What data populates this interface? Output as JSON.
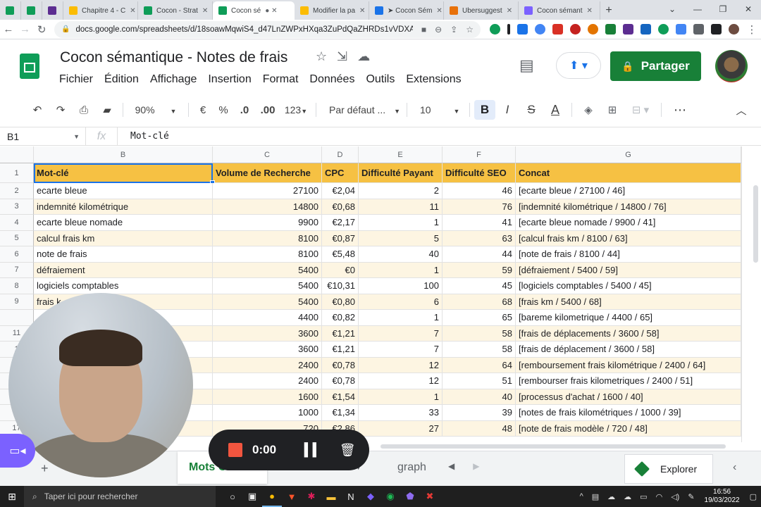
{
  "browser": {
    "tabs": [
      {
        "title": "",
        "color": "#0f9d58",
        "active": false
      },
      {
        "title": "",
        "color": "#0f9d58",
        "active": false
      },
      {
        "title": "",
        "color": "#5c2d91",
        "active": false
      },
      {
        "title": "Chapitre 4 - C",
        "color": "#fbbc04",
        "active": false
      },
      {
        "title": "Cocon - Strat",
        "color": "#0f9d58",
        "active": false
      },
      {
        "title": "Cocon sé",
        "color": "#0f9d58",
        "active": true
      },
      {
        "title": "Modifier la pa",
        "color": "#fbbc04",
        "active": false
      },
      {
        "title": "➤ Cocon Sém",
        "color": "#1a73e8",
        "active": false
      },
      {
        "title": "Ubersuggest",
        "color": "#e8710a",
        "active": false
      },
      {
        "title": "Cocon sémant",
        "color": "#7b61ff",
        "active": false
      }
    ],
    "url": "docs.google.com/spreadsheets/d/18soawMqwiS4_d47LnZWPxHXqa3ZuPdQaZHRDs1vVDXA/ed..."
  },
  "doc": {
    "title": "Cocon sémantique - Notes de frais",
    "menu": [
      "Fichier",
      "Édition",
      "Affichage",
      "Insertion",
      "Format",
      "Données",
      "Outils",
      "Extensions"
    ],
    "share_label": "Partager"
  },
  "toolbar": {
    "zoom": "90%",
    "currency": "€",
    "percent": "%",
    "dec_less": ".0",
    "dec_more": ".00",
    "format_more": "123",
    "font": "Par défaut ...",
    "font_size": "10",
    "bold": "B",
    "italic": "I",
    "strike": "S",
    "text_color": "A"
  },
  "formula": {
    "name_box": "B1",
    "fx": "fx",
    "value": "Mot-clé"
  },
  "grid": {
    "columns": [
      {
        "letter": "B",
        "header": "Mot-clé"
      },
      {
        "letter": "C",
        "header": "Volume de Recherche"
      },
      {
        "letter": "D",
        "header": "CPC"
      },
      {
        "letter": "E",
        "header": "Difficulté Payant"
      },
      {
        "letter": "F",
        "header": "Difficulté SEO"
      },
      {
        "letter": "G",
        "header": "Concat"
      }
    ],
    "rows": [
      {
        "num": "2",
        "kw": "ecarte bleue",
        "vol": "27100",
        "cpc": "€2,04",
        "dp": "2",
        "seo": "46",
        "concat": "[ecarte bleue / 27100 / 46]"
      },
      {
        "num": "3",
        "kw": "indemnité kilométrique",
        "vol": "14800",
        "cpc": "€0,68",
        "dp": "11",
        "seo": "76",
        "concat": "[indemnité kilométrique / 14800 / 76]"
      },
      {
        "num": "4",
        "kw": "ecarte bleue nomade",
        "vol": "9900",
        "cpc": "€2,17",
        "dp": "1",
        "seo": "41",
        "concat": "[ecarte bleue nomade / 9900 / 41]"
      },
      {
        "num": "5",
        "kw": "calcul frais km",
        "vol": "8100",
        "cpc": "€0,87",
        "dp": "5",
        "seo": "63",
        "concat": "[calcul frais km / 8100 / 63]"
      },
      {
        "num": "6",
        "kw": "note de frais",
        "vol": "8100",
        "cpc": "€5,48",
        "dp": "40",
        "seo": "44",
        "concat": "[note de frais / 8100 / 44]"
      },
      {
        "num": "7",
        "kw": "défraiement",
        "vol": "5400",
        "cpc": "€0",
        "dp": "1",
        "seo": "59",
        "concat": "[défraiement / 5400 / 59]"
      },
      {
        "num": "8",
        "kw": "logiciels comptables",
        "vol": "5400",
        "cpc": "€10,31",
        "dp": "100",
        "seo": "45",
        "concat": "[logiciels comptables / 5400 / 45]"
      },
      {
        "num": "9",
        "kw": "frais k",
        "vol": "5400",
        "cpc": "€0,80",
        "dp": "6",
        "seo": "68",
        "concat": "[frais km / 5400 / 68]"
      },
      {
        "num": "",
        "kw": "",
        "vol": "4400",
        "cpc": "€0,82",
        "dp": "1",
        "seo": "65",
        "concat": "[bareme kilometrique / 4400 / 65]"
      },
      {
        "num": "11",
        "kw": "",
        "vol": "3600",
        "cpc": "€1,21",
        "dp": "7",
        "seo": "58",
        "concat": "[frais de déplacements / 3600 / 58]"
      },
      {
        "num": "1",
        "kw": "",
        "vol": "3600",
        "cpc": "€1,21",
        "dp": "7",
        "seo": "58",
        "concat": "[frais de déplacement / 3600 / 58]"
      },
      {
        "num": "",
        "kw": "",
        "vol": "2400",
        "cpc": "€0,78",
        "dp": "12",
        "seo": "64",
        "concat": "[remboursement frais kilométrique / 2400 / 64]"
      },
      {
        "num": "",
        "kw": "",
        "vol": "2400",
        "cpc": "€0,78",
        "dp": "12",
        "seo": "51",
        "concat": "[rembourser frais kilometriques / 2400 / 51]"
      },
      {
        "num": "",
        "kw": "",
        "vol": "1600",
        "cpc": "€1,54",
        "dp": "1",
        "seo": "40",
        "concat": "[processus d'achat / 1600 / 40]"
      },
      {
        "num": "",
        "kw": "",
        "vol": "1000",
        "cpc": "€1,34",
        "dp": "33",
        "seo": "39",
        "concat": "[notes de frais kilométriques / 1000 / 39]"
      },
      {
        "num": "17",
        "kw": "",
        "vol": "720",
        "cpc": "€2,86",
        "dp": "27",
        "seo": "48",
        "concat": "[note de frais modèle / 720 / 48]"
      }
    ]
  },
  "sheets": {
    "tabs": [
      {
        "label": "...res",
        "active": false
      },
      {
        "label": "Mots Clés",
        "active": true
      },
      {
        "label": "Dashboard",
        "active": false
      },
      {
        "label": "graph",
        "active": false
      }
    ],
    "explore_label": "Explorer"
  },
  "recorder": {
    "time": "0:00"
  },
  "taskbar": {
    "search_placeholder": "Taper ici pour rechercher",
    "time": "16:56",
    "date": "19/03/2022"
  },
  "colors": {
    "header_fill": "#f6c143",
    "band_fill": "#fdf5e2",
    "sheets_green": "#188038",
    "selection_blue": "#1a73e8"
  }
}
